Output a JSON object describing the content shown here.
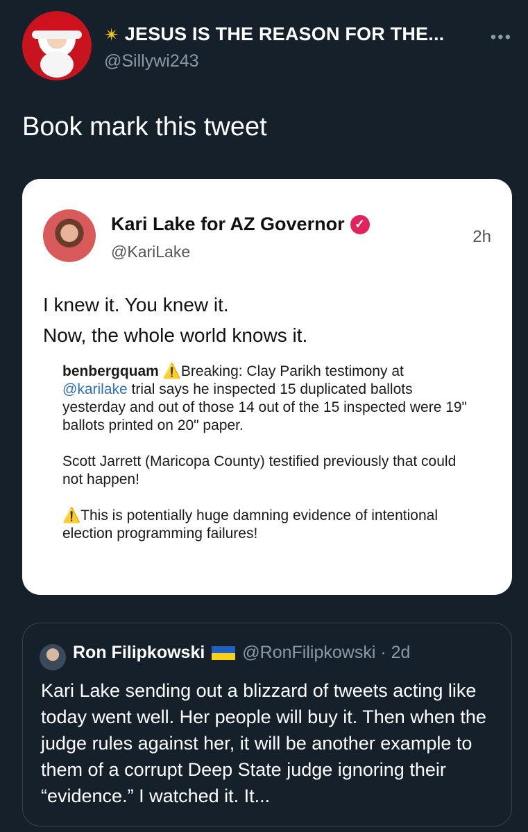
{
  "author": {
    "display_name": "JESUS IS THE REASON FOR THE...",
    "handle": "@Sillywi243",
    "more_label": "•••",
    "star_icon": "✴"
  },
  "tweet": {
    "text": "Book mark this tweet"
  },
  "embedded": {
    "name": "Kari Lake for AZ Governor",
    "handle": "@KariLake",
    "time": "2h",
    "verified_icon": "✓",
    "line1": "I knew it. You knew it.",
    "line2": "Now, the whole world knows it.",
    "quote": {
      "author": "benbergquam",
      "warn": "⚠️",
      "text1_a": "Breaking: Clay Parikh testimony at",
      "mention": "@karilake",
      "text1_b": "trial says he inspected 15 duplicated ballots yesterday and out of those 14 out of the 15 inspected were 19\" ballots printed on 20\" paper.",
      "text2": "Scott Jarrett (Maricopa County) testified previously that could not happen!",
      "warn2": "⚠️",
      "text3": "This is potentially huge damning evidence of intentional election programming failures!"
    }
  },
  "quoted": {
    "name": "Ron Filipkowski",
    "handle_time": "@RonFilipkowski · 2d",
    "text": "Kari Lake sending out a blizzard of tweets acting like today went well. Her people will buy it. Then when the judge rules against her, it will be another example to them of a corrupt Deep State judge ignoring their “evidence.” I watched it. It..."
  },
  "colors": {
    "background": "#15202b",
    "muted": "#8b98a5",
    "verified": "#e0245e",
    "mention": "#2e6fb8"
  }
}
